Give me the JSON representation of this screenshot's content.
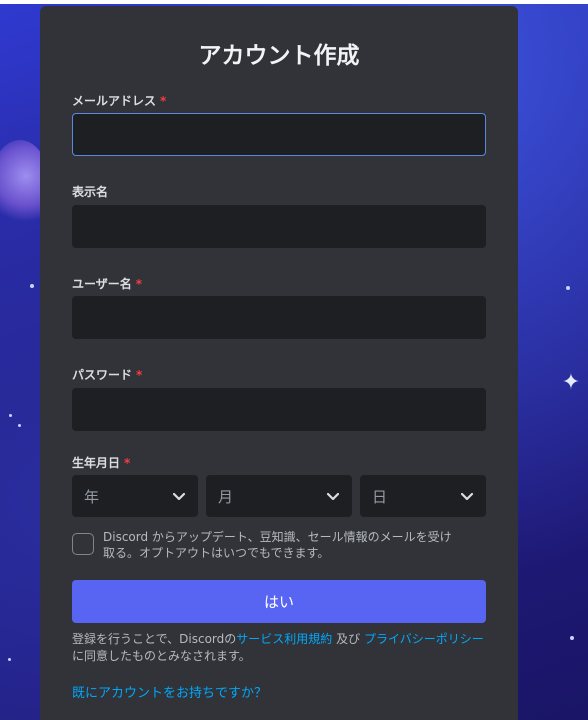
{
  "form": {
    "title": "アカウント作成",
    "required_mark": "*",
    "email": {
      "label": "メールアドレス",
      "value": ""
    },
    "display_name": {
      "label": "表示名",
      "value": ""
    },
    "username": {
      "label": "ユーザー名",
      "value": ""
    },
    "password": {
      "label": "パスワード",
      "value": ""
    },
    "birthdate": {
      "label": "生年月日",
      "year_placeholder": "年",
      "month_placeholder": "月",
      "day_placeholder": "日"
    },
    "opt_in_text": "Discord からアップデート、豆知識、セール情報のメールを受け取る。オプトアウトはいつでもできます。",
    "submit_label": "はい",
    "terms": {
      "prefix": "登録を行うことで、Discordの",
      "tos_link": "サービス利用規約",
      "middle": " 及び ",
      "privacy_link": "プライバシーポリシー",
      "suffix": "に同意したものとみなされます。"
    },
    "login_link": "既にアカウントをお持ちですか？"
  },
  "colors": {
    "card": "#313338",
    "input": "#1e1f22",
    "accent": "#5865f2",
    "link": "#00a8fc",
    "required": "#f23f43"
  },
  "icons": {
    "chevron": "chevron-down-icon"
  }
}
